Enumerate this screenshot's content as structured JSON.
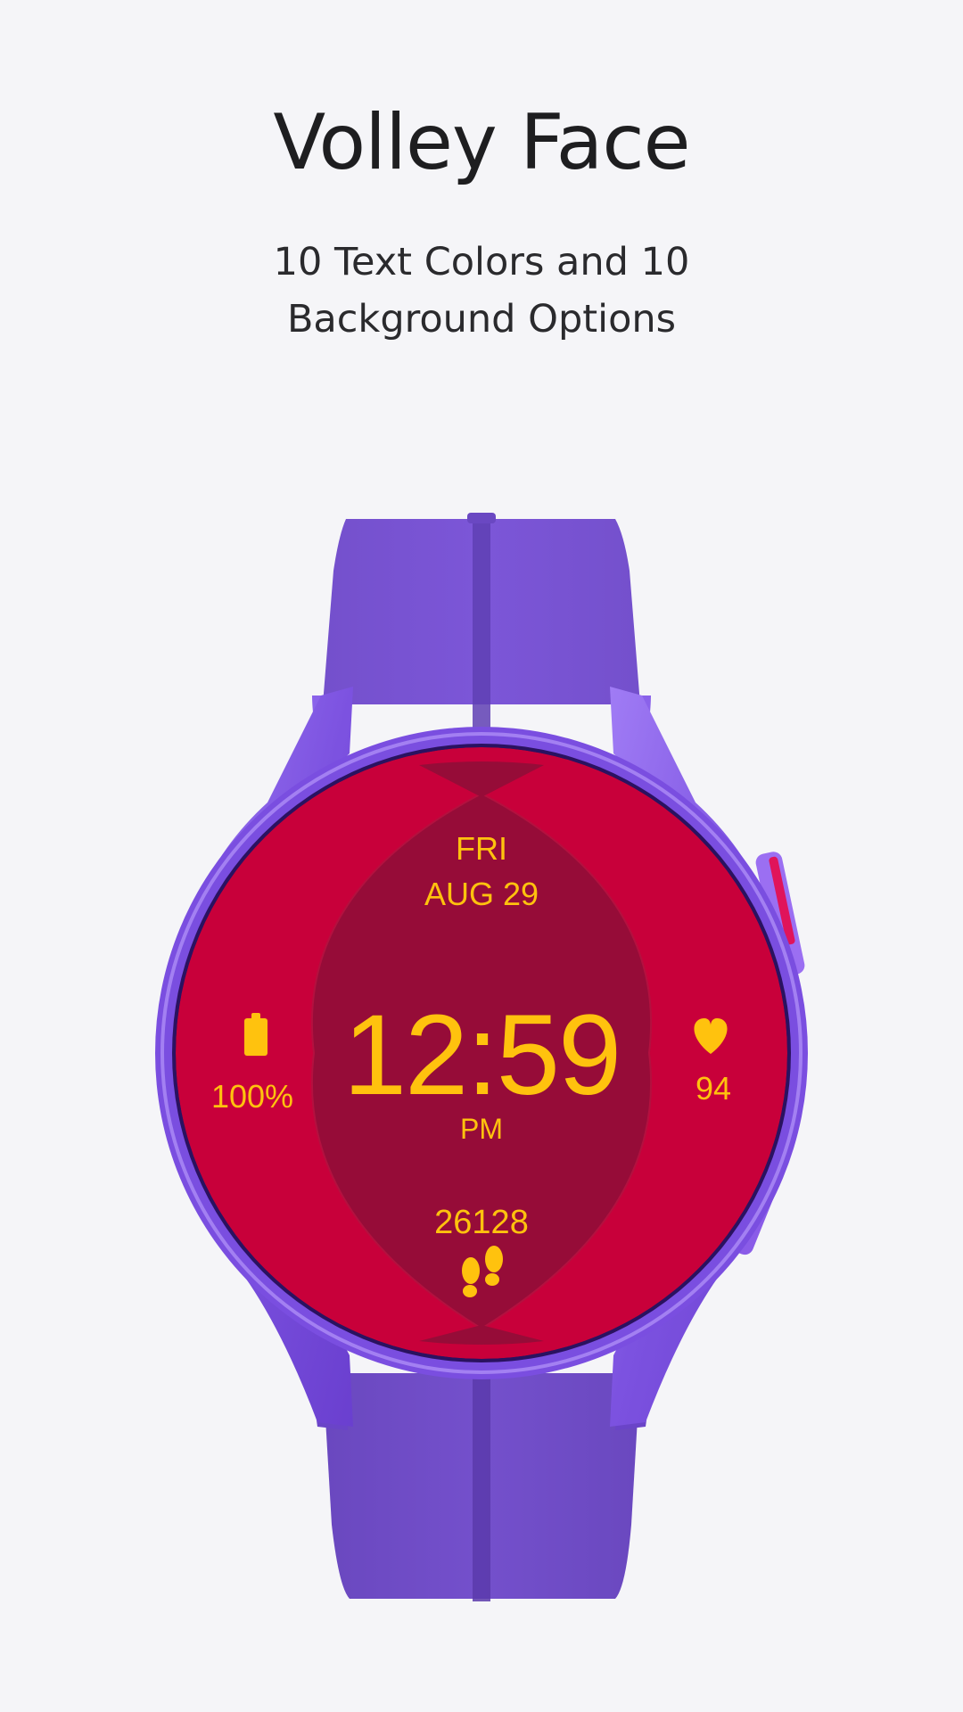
{
  "header": {
    "title": "Volley Face",
    "subtitle_line1": "10 Text Colors and 10",
    "subtitle_line2": "Background Options"
  },
  "watch_face": {
    "day": "FRI",
    "date": "AUG 29",
    "time": "12:59",
    "ampm": "PM",
    "battery": "100%",
    "heart_rate": "94",
    "steps": "26128"
  },
  "icons": {
    "battery": "battery-icon",
    "heart": "heart-icon",
    "steps": "footsteps-icon"
  },
  "colors": {
    "page_background": "#f5f5f8",
    "title_text": "#1e1e20",
    "band_purple": "#7a52d4",
    "case_purple": "#8a5ce8",
    "face_red": "#c8003a",
    "face_center": "#960c38",
    "accent_text": "#ffc20e"
  }
}
